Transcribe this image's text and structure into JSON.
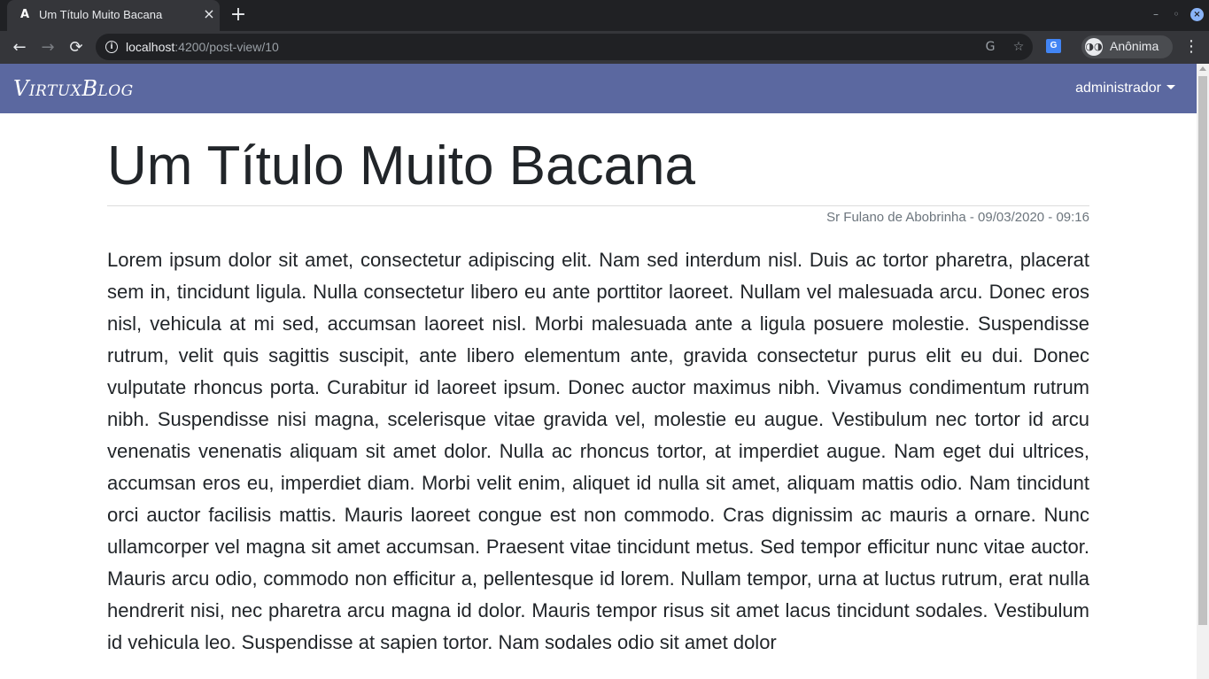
{
  "browser": {
    "tab": {
      "favicon": "A",
      "title": "Um Título Muito Bacana",
      "close": "×"
    },
    "new_tab": "+",
    "window": {
      "minimize": "–",
      "restore": "◦",
      "close": "×"
    },
    "nav": {
      "back": "←",
      "forward": "→",
      "reload": "⟳"
    },
    "url": {
      "host": "localhost",
      "rest": ":4200/post-view/10"
    },
    "icons": {
      "translate": "G",
      "bookmark": "☆",
      "translate_ext": "G"
    },
    "profile": {
      "icon": "◑◑",
      "label": "Anônima"
    },
    "menu": "⋮"
  },
  "navbar": {
    "brand": "VirtuxBlog",
    "user": "administrador"
  },
  "post": {
    "title": "Um Título Muito Bacana",
    "meta": "Sr Fulano de Abobrinha - 09/03/2020 - 09:16",
    "body": "Lorem ipsum dolor sit amet, consectetur adipiscing elit. Nam sed interdum nisl. Duis ac tortor pharetra, placerat sem in, tincidunt ligula. Nulla consectetur libero eu ante porttitor laoreet. Nullam vel malesuada arcu. Donec eros nisl, vehicula at mi sed, accumsan laoreet nisl. Morbi malesuada ante a ligula posuere molestie. Suspendisse rutrum, velit quis sagittis suscipit, ante libero elementum ante, gravida consectetur purus elit eu dui. Donec vulputate rhoncus porta. Curabitur id laoreet ipsum. Donec auctor maximus nibh. Vivamus condimentum rutrum nibh. Suspendisse nisi magna, scelerisque vitae gravida vel, molestie eu augue. Vestibulum nec tortor id arcu venenatis venenatis aliquam sit amet dolor. Nulla ac rhoncus tortor, at imperdiet augue. Nam eget dui ultrices, accumsan eros eu, imperdiet diam. Morbi velit enim, aliquet id nulla sit amet, aliquam mattis odio. Nam tincidunt orci auctor facilisis mattis. Mauris laoreet congue est non commodo. Cras dignissim ac mauris a ornare. Nunc ullamcorper vel magna sit amet accumsan. Praesent vitae tincidunt metus. Sed tempor efficitur nunc vitae auctor. Mauris arcu odio, commodo non efficitur a, pellentesque id lorem. Nullam tempor, urna at luctus rutrum, erat nulla hendrerit nisi, nec pharetra arcu magna id dolor. Mauris tempor risus sit amet lacus tincidunt sodales. Vestibulum id vehicula leo. Suspendisse at sapien tortor. Nam sodales odio sit amet dolor"
  },
  "colors": {
    "navbar": "#5b68a0",
    "browser_frame": "#202124",
    "toolbar": "#35363a",
    "text": "#212529",
    "meta_text": "#6c757d"
  }
}
